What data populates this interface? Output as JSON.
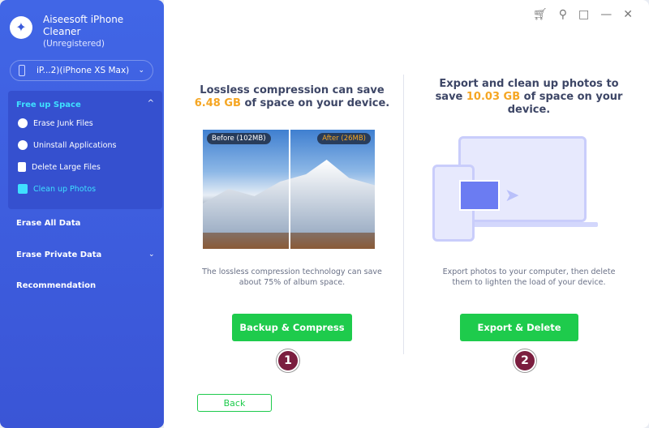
{
  "app": {
    "name": "Aiseesoft iPhone Cleaner",
    "status": "(Unregistered)"
  },
  "device": {
    "label": "iP...2)(iPhone XS Max)"
  },
  "sidebar": {
    "group": "Free up Space",
    "items": [
      {
        "label": "Erase Junk Files",
        "icon": "clock-icon"
      },
      {
        "label": "Uninstall Applications",
        "icon": "app-store-icon"
      },
      {
        "label": "Delete Large Files",
        "icon": "file-icon"
      },
      {
        "label": "Clean up Photos",
        "icon": "photo-icon",
        "active": true
      }
    ],
    "nav": [
      {
        "label": "Erase All Data"
      },
      {
        "label": "Erase Private Data"
      },
      {
        "label": "Recommendation"
      }
    ]
  },
  "toolbar": [
    "cart-icon",
    "key-icon",
    "menu-icon",
    "feedback-icon",
    "minimize-icon",
    "close-icon"
  ],
  "left": {
    "h1": "Lossless compression can save",
    "size": "6.48 GB",
    "h2": " of space on your device.",
    "before": "Before (102MB)",
    "after": "After (26MB)",
    "desc1": "The lossless compression technology can save",
    "desc2": "about 75% of album space.",
    "button": "Backup & Compress",
    "step": "1"
  },
  "right": {
    "h1": "Export and clean up photos to",
    "pre": "save ",
    "size": "10.03 GB",
    "h2": " of space on your",
    "h3": "device.",
    "desc1": "Export photos to your computer, then delete",
    "desc2": "them to lighten the load of your device.",
    "button": "Export & Delete",
    "step": "2"
  },
  "back": "Back",
  "colors": {
    "sidebar": "#3b5bdb",
    "accent": "#1ecb4c",
    "highlight": "#f5a623",
    "active": "#3fe0ff"
  }
}
